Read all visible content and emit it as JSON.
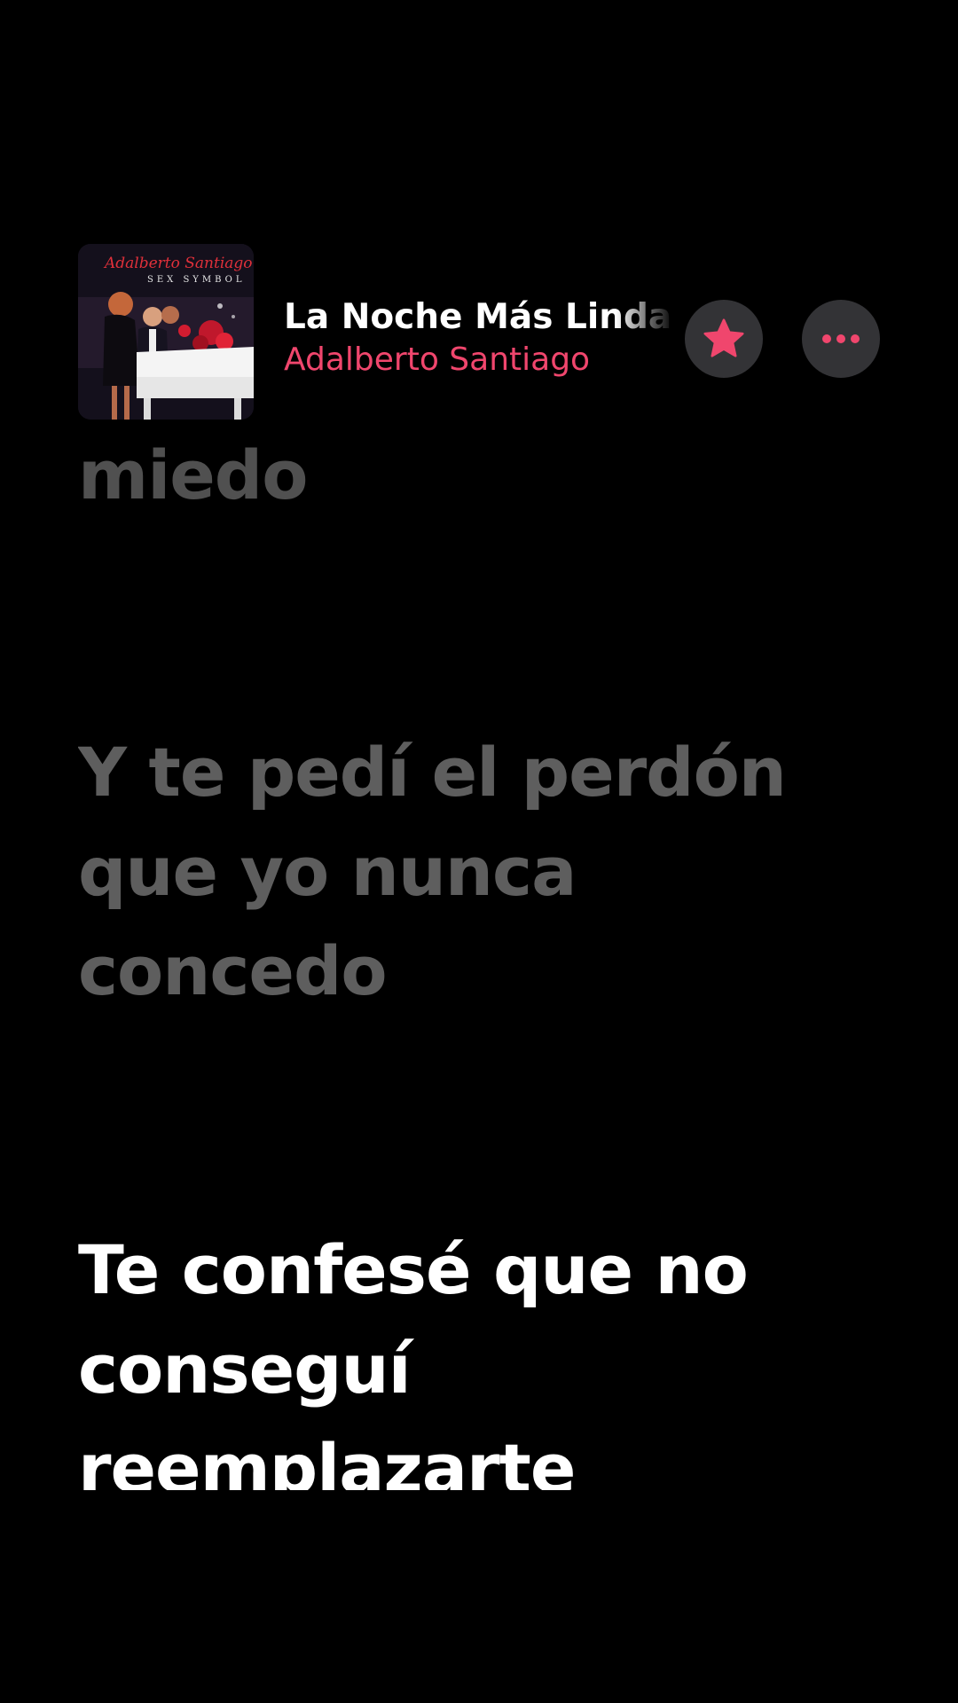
{
  "now_playing": {
    "title": "La Noche Más Linda",
    "artist": "Adalberto Santiago",
    "artwork": {
      "title_text": "Adalberto Santiago",
      "subtitle_text": "SEX SYMBOL"
    },
    "favorite_icon": "star-icon",
    "more_icon": "ellipsis-icon"
  },
  "colors": {
    "background": "#000000",
    "accent": "#f0466d",
    "lyric_active": "#ffffff",
    "lyric_inactive": "#5e5e5e",
    "button_bg": "#333336"
  },
  "lyrics": {
    "previous_tail": "miedo",
    "previous_line": "Y te pedí el perdón que yo nunca concedo",
    "current_line": "Te confesé que no conseguí reemplazarte"
  }
}
